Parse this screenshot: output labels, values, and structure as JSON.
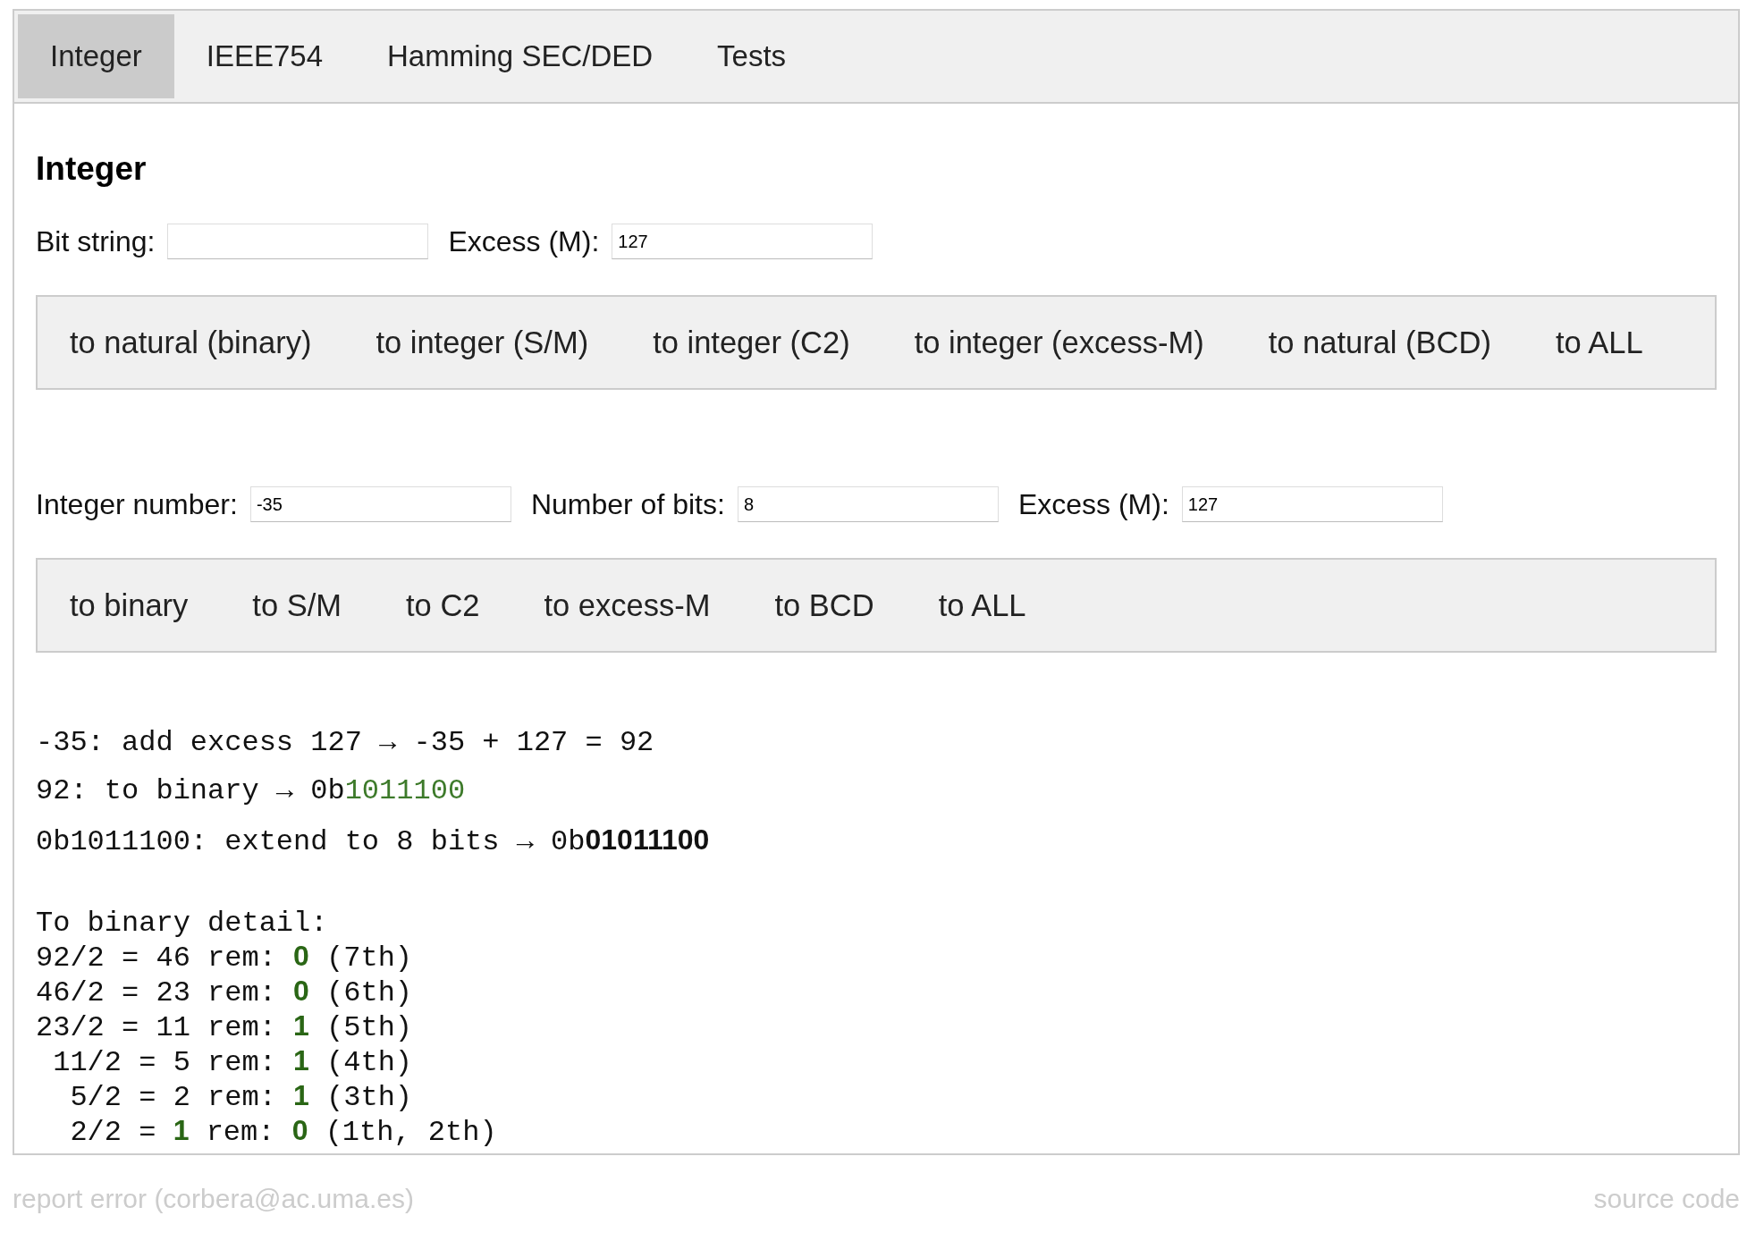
{
  "tabs": [
    {
      "label": "Integer",
      "selected": true
    },
    {
      "label": "IEEE754",
      "selected": false
    },
    {
      "label": "Hamming SEC/DED",
      "selected": false
    },
    {
      "label": "Tests",
      "selected": false
    }
  ],
  "heading": "Integer",
  "decode": {
    "fields": [
      {
        "label": "Bit string:"
      },
      {
        "label": "Excess (M):",
        "value": "127"
      }
    ],
    "buttons": [
      "to natural (binary)",
      "to integer (S/M)",
      "to integer (C2)",
      "to integer (excess-M)",
      "to natural (BCD)",
      "to ALL"
    ]
  },
  "encode": {
    "fields": [
      {
        "label": "Integer number:",
        "value": "-35"
      },
      {
        "label": "Number of bits:",
        "value": "8"
      },
      {
        "label": "Excess (M):",
        "value": "127"
      }
    ],
    "buttons": [
      "to binary",
      "to S/M",
      "to C2",
      "to excess-M",
      "to BCD",
      "to ALL"
    ]
  },
  "steps": [
    [
      {
        "text": "-35: add excess 127 → -35 + 127 = 92",
        "kind": "plain"
      }
    ],
    [
      {
        "text": "92: to binary → 0b",
        "kind": "plain"
      },
      {
        "text": "1011100",
        "kind": "result"
      }
    ],
    [
      {
        "text": "0b1011100: extend to 8 bits → 0b",
        "kind": "plain"
      },
      {
        "text": "01011100",
        "kind": "final"
      }
    ]
  ],
  "detail_title": "To binary detail:",
  "detail": [
    [
      {
        "text": "92/2 = 46 rem: ",
        "kind": "plain"
      },
      {
        "text": "0",
        "kind": "digit"
      },
      {
        "text": " (7th)",
        "kind": "plain"
      }
    ],
    [
      {
        "text": "46/2 = 23 rem: ",
        "kind": "plain"
      },
      {
        "text": "0",
        "kind": "digit"
      },
      {
        "text": " (6th)",
        "kind": "plain"
      }
    ],
    [
      {
        "text": "23/2 = 11 rem: ",
        "kind": "plain"
      },
      {
        "text": "1",
        "kind": "digit"
      },
      {
        "text": " (5th)",
        "kind": "plain"
      }
    ],
    [
      {
        "text": " 11/2 = 5 rem: ",
        "kind": "plain"
      },
      {
        "text": "1",
        "kind": "digit"
      },
      {
        "text": " (4th)",
        "kind": "plain"
      }
    ],
    [
      {
        "text": "  5/2 = 2 rem: ",
        "kind": "plain"
      },
      {
        "text": "1",
        "kind": "digit"
      },
      {
        "text": " (3th)",
        "kind": "plain"
      }
    ],
    [
      {
        "text": "  2/2 = ",
        "kind": "plain"
      },
      {
        "text": "1",
        "kind": "digit"
      },
      {
        "text": " rem: ",
        "kind": "plain"
      },
      {
        "text": "0",
        "kind": "digit"
      },
      {
        "text": " (1th, 2th)",
        "kind": "plain"
      }
    ]
  ],
  "footer": {
    "report": "report error (corbera@ac.uma.es)",
    "source": "source code"
  }
}
